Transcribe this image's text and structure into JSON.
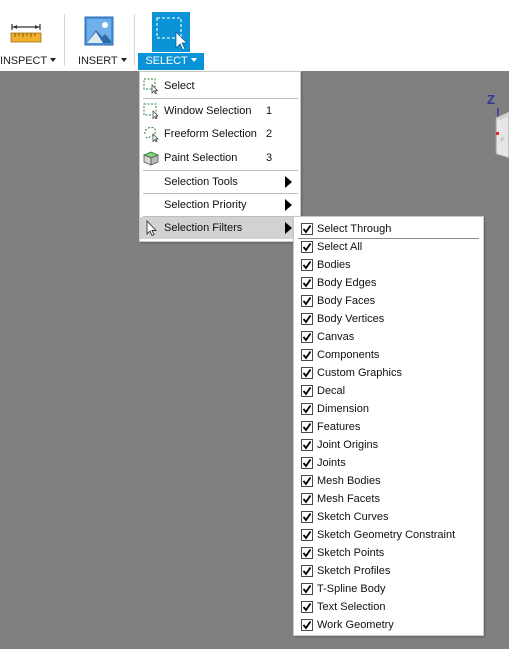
{
  "toolbar": {
    "inspect": {
      "label": "INSPECT",
      "icon": "ruler-icon"
    },
    "insert": {
      "label": "INSERT",
      "icon": "image-icon"
    },
    "select": {
      "label": "SELECT",
      "icon": "selection-cursor-icon",
      "active": true,
      "accent": "#0a93d6"
    }
  },
  "viewcube": {
    "axis_label": "Z",
    "axis_color": "#2a3a9a",
    "accent_color": "#e8282d"
  },
  "select_menu": {
    "items": [
      {
        "label": "Select",
        "icon": "cursor-select-icon",
        "shortcut": ""
      },
      {
        "label": "Window Selection",
        "icon": "window-selection-icon",
        "shortcut": "1"
      },
      {
        "label": "Freeform Selection",
        "icon": "freeform-selection-icon",
        "shortcut": "2"
      },
      {
        "label": "Paint Selection",
        "icon": "paint-selection-icon",
        "shortcut": "3"
      },
      {
        "label": "Selection Tools",
        "has_submenu": true
      },
      {
        "label": "Selection Priority",
        "has_submenu": true
      },
      {
        "label": "Selection Filters",
        "has_submenu": true,
        "hovered": true,
        "icon": "cursor-icon"
      }
    ]
  },
  "filters_menu": {
    "select_through": {
      "label": "Select Through",
      "checked": true
    },
    "items": [
      {
        "label": "Select All",
        "checked": true
      },
      {
        "label": "Bodies",
        "checked": true
      },
      {
        "label": "Body Edges",
        "checked": true
      },
      {
        "label": "Body Faces",
        "checked": true
      },
      {
        "label": "Body Vertices",
        "checked": true
      },
      {
        "label": "Canvas",
        "checked": true
      },
      {
        "label": "Components",
        "checked": true
      },
      {
        "label": "Custom Graphics",
        "checked": true
      },
      {
        "label": "Decal",
        "checked": true
      },
      {
        "label": "Dimension",
        "checked": true
      },
      {
        "label": "Features",
        "checked": true
      },
      {
        "label": "Joint Origins",
        "checked": true
      },
      {
        "label": "Joints",
        "checked": true
      },
      {
        "label": "Mesh Bodies",
        "checked": true
      },
      {
        "label": "Mesh Facets",
        "checked": true
      },
      {
        "label": "Sketch Curves",
        "checked": true
      },
      {
        "label": "Sketch Geometry Constraint",
        "checked": true
      },
      {
        "label": "Sketch Points",
        "checked": true
      },
      {
        "label": "Sketch Profiles",
        "checked": true
      },
      {
        "label": "T-Spline Body",
        "checked": true
      },
      {
        "label": "Text Selection",
        "checked": true
      },
      {
        "label": "Work Geometry",
        "checked": true
      }
    ]
  }
}
